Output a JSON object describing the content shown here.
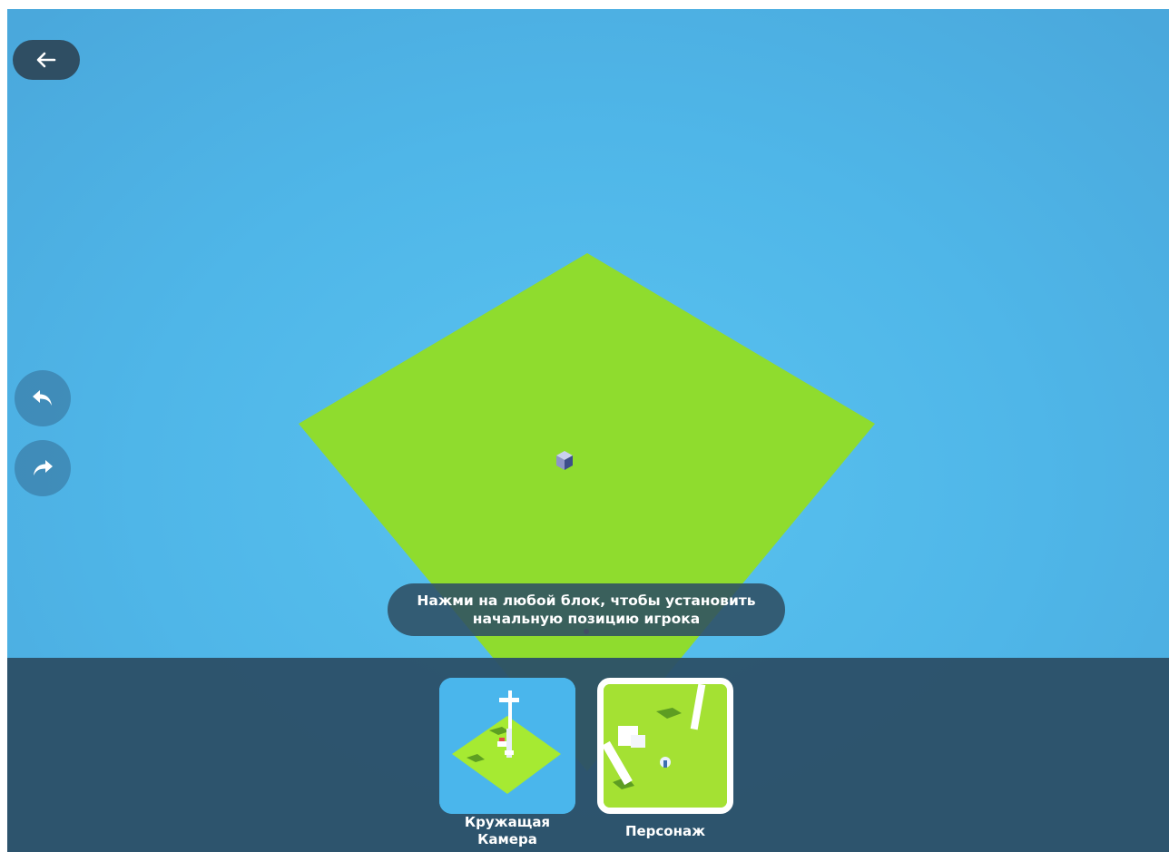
{
  "scene": {
    "sky_color": "#4fb6e8",
    "ground_color": "#8fdc2e"
  },
  "toolbar": {
    "back_icon": "arrow-left-icon",
    "undo_icon": "undo-icon",
    "redo_icon": "redo-icon"
  },
  "hint": {
    "text": "Нажми на любой блок, чтобы установить\nначальную позицию игрока"
  },
  "panel": {
    "cards": [
      {
        "label": "Кружащая\nКамера",
        "icon": "orbit-camera-thumbnail",
        "selected": false
      },
      {
        "label": "Персонаж",
        "icon": "character-camera-thumbnail",
        "selected": true
      }
    ]
  }
}
